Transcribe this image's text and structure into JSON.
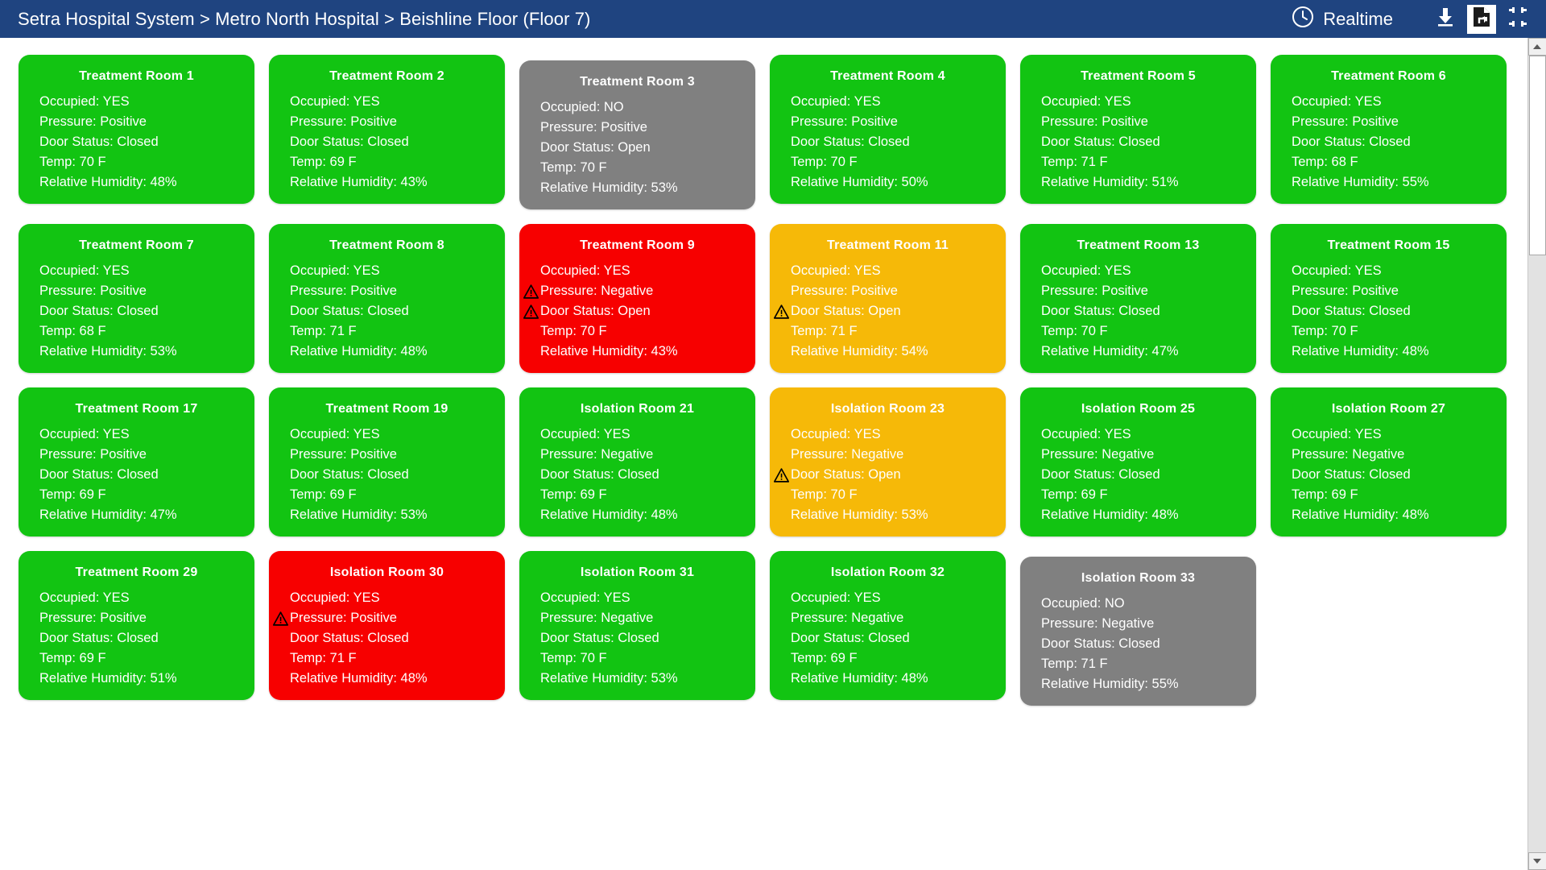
{
  "header": {
    "breadcrumb": "Setra Hospital System > Metro North Hospital > Beishline Floor (Floor 7)",
    "mode_label": "Realtime",
    "clock_icon": "clock-icon",
    "download_icon": "download-icon",
    "export_icon": "export-document-icon",
    "collapse_icon": "collapse-fullscreen-icon"
  },
  "labels": {
    "occupied": "Occupied",
    "pressure": "Pressure",
    "door_status": "Door Status",
    "temp": "Temp",
    "humidity": "Relative Humidity"
  },
  "colors": {
    "header_bg": "#1f4480",
    "status_green": "#12c412",
    "status_red": "#f70000",
    "status_yellow": "#f6b908",
    "status_gray": "#808080",
    "text": "#ffffff",
    "warning": "#000000"
  },
  "rooms": [
    [
      {
        "name": "Treatment Room 1",
        "status": "green",
        "lines": [
          {
            "text": "Occupied: YES",
            "warn": false
          },
          {
            "text": "Pressure: Positive",
            "warn": false
          },
          {
            "text": "Door Status: Closed",
            "warn": false
          },
          {
            "text": "Temp: 70 F",
            "warn": false
          },
          {
            "text": "Relative Humidity: 48%",
            "warn": false
          }
        ]
      },
      {
        "name": "Treatment Room 2",
        "status": "green",
        "lines": [
          {
            "text": "Occupied: YES",
            "warn": false
          },
          {
            "text": "Pressure: Positive",
            "warn": false
          },
          {
            "text": "Door Status: Closed",
            "warn": false
          },
          {
            "text": "Temp: 69 F",
            "warn": false
          },
          {
            "text": "Relative Humidity: 43%",
            "warn": false
          }
        ]
      },
      {
        "name": "Treatment Room 3",
        "status": "gray",
        "lines": [
          {
            "text": "Occupied: NO",
            "warn": false
          },
          {
            "text": "Pressure: Positive",
            "warn": false
          },
          {
            "text": "Door Status: Open",
            "warn": false
          },
          {
            "text": "Temp: 70 F",
            "warn": false
          },
          {
            "text": "Relative Humidity: 53%",
            "warn": false
          }
        ]
      },
      {
        "name": "Treatment Room 4",
        "status": "green",
        "lines": [
          {
            "text": "Occupied: YES",
            "warn": false
          },
          {
            "text": "Pressure: Positive",
            "warn": false
          },
          {
            "text": "Door Status: Closed",
            "warn": false
          },
          {
            "text": "Temp: 70 F",
            "warn": false
          },
          {
            "text": "Relative Humidity: 50%",
            "warn": false
          }
        ]
      },
      {
        "name": "Treatment Room 5",
        "status": "green",
        "lines": [
          {
            "text": "Occupied: YES",
            "warn": false
          },
          {
            "text": "Pressure: Positive",
            "warn": false
          },
          {
            "text": "Door Status: Closed",
            "warn": false
          },
          {
            "text": "Temp: 71 F",
            "warn": false
          },
          {
            "text": "Relative Humidity: 51%",
            "warn": false
          }
        ]
      },
      {
        "name": "Treatment Room 6",
        "status": "green",
        "lines": [
          {
            "text": "Occupied: YES",
            "warn": false
          },
          {
            "text": "Pressure: Positive",
            "warn": false
          },
          {
            "text": "Door Status: Closed",
            "warn": false
          },
          {
            "text": "Temp: 68 F",
            "warn": false
          },
          {
            "text": "Relative Humidity: 55%",
            "warn": false
          }
        ]
      }
    ],
    [
      {
        "name": "Treatment Room 7",
        "status": "green",
        "lines": [
          {
            "text": "Occupied: YES",
            "warn": false
          },
          {
            "text": "Pressure: Positive",
            "warn": false
          },
          {
            "text": "Door Status: Closed",
            "warn": false
          },
          {
            "text": "Temp: 68 F",
            "warn": false
          },
          {
            "text": "Relative Humidity: 53%",
            "warn": false
          }
        ]
      },
      {
        "name": "Treatment Room 8",
        "status": "green",
        "lines": [
          {
            "text": "Occupied: YES",
            "warn": false
          },
          {
            "text": "Pressure: Positive",
            "warn": false
          },
          {
            "text": "Door Status: Closed",
            "warn": false
          },
          {
            "text": "Temp: 71 F",
            "warn": false
          },
          {
            "text": "Relative Humidity: 48%",
            "warn": false
          }
        ]
      },
      {
        "name": "Treatment Room 9",
        "status": "red",
        "lines": [
          {
            "text": "Occupied: YES",
            "warn": false
          },
          {
            "text": "Pressure: Negative",
            "warn": true
          },
          {
            "text": "Door Status: Open",
            "warn": true
          },
          {
            "text": "Temp: 70 F",
            "warn": false
          },
          {
            "text": "Relative Humidity: 43%",
            "warn": false
          }
        ]
      },
      {
        "name": "Treatment Room 11",
        "status": "yellow",
        "lines": [
          {
            "text": "Occupied: YES",
            "warn": false
          },
          {
            "text": "Pressure: Positive",
            "warn": false
          },
          {
            "text": "Door Status: Open",
            "warn": true
          },
          {
            "text": "Temp: 71 F",
            "warn": false
          },
          {
            "text": "Relative Humidity: 54%",
            "warn": false
          }
        ]
      },
      {
        "name": "Treatment Room 13",
        "status": "green",
        "lines": [
          {
            "text": "Occupied: YES",
            "warn": false
          },
          {
            "text": "Pressure: Positive",
            "warn": false
          },
          {
            "text": "Door Status: Closed",
            "warn": false
          },
          {
            "text": "Temp: 70 F",
            "warn": false
          },
          {
            "text": "Relative Humidity: 47%",
            "warn": false
          }
        ]
      },
      {
        "name": "Treatment Room 15",
        "status": "green",
        "lines": [
          {
            "text": "Occupied: YES",
            "warn": false
          },
          {
            "text": "Pressure: Positive",
            "warn": false
          },
          {
            "text": "Door Status: Closed",
            "warn": false
          },
          {
            "text": "Temp: 70 F",
            "warn": false
          },
          {
            "text": "Relative Humidity: 48%",
            "warn": false
          }
        ]
      }
    ],
    [
      {
        "name": "Treatment Room 17",
        "status": "green",
        "lines": [
          {
            "text": "Occupied: YES",
            "warn": false
          },
          {
            "text": "Pressure: Positive",
            "warn": false
          },
          {
            "text": "Door Status: Closed",
            "warn": false
          },
          {
            "text": "Temp: 69 F",
            "warn": false
          },
          {
            "text": "Relative Humidity: 47%",
            "warn": false
          }
        ]
      },
      {
        "name": "Treatment Room 19",
        "status": "green",
        "lines": [
          {
            "text": "Occupied: YES",
            "warn": false
          },
          {
            "text": "Pressure: Positive",
            "warn": false
          },
          {
            "text": "Door Status: Closed",
            "warn": false
          },
          {
            "text": "Temp: 69 F",
            "warn": false
          },
          {
            "text": "Relative Humidity: 53%",
            "warn": false
          }
        ]
      },
      {
        "name": "Isolation Room 21",
        "status": "green",
        "lines": [
          {
            "text": "Occupied: YES",
            "warn": false
          },
          {
            "text": "Pressure: Negative",
            "warn": false
          },
          {
            "text": "Door Status: Closed",
            "warn": false
          },
          {
            "text": "Temp: 69 F",
            "warn": false
          },
          {
            "text": "Relative Humidity: 48%",
            "warn": false
          }
        ]
      },
      {
        "name": "Isolation Room 23",
        "status": "yellow",
        "lines": [
          {
            "text": "Occupied: YES",
            "warn": false
          },
          {
            "text": "Pressure: Negative",
            "warn": false
          },
          {
            "text": "Door Status: Open",
            "warn": true
          },
          {
            "text": "Temp: 70 F",
            "warn": false
          },
          {
            "text": "Relative Humidity: 53%",
            "warn": false
          }
        ]
      },
      {
        "name": "Isolation Room 25",
        "status": "green",
        "lines": [
          {
            "text": "Occupied: YES",
            "warn": false
          },
          {
            "text": "Pressure: Negative",
            "warn": false
          },
          {
            "text": "Door Status: Closed",
            "warn": false
          },
          {
            "text": "Temp: 69 F",
            "warn": false
          },
          {
            "text": "Relative Humidity: 48%",
            "warn": false
          }
        ]
      },
      {
        "name": "Isolation Room 27",
        "status": "green",
        "lines": [
          {
            "text": "Occupied: YES",
            "warn": false
          },
          {
            "text": "Pressure: Negative",
            "warn": false
          },
          {
            "text": "Door Status: Closed",
            "warn": false
          },
          {
            "text": "Temp: 69 F",
            "warn": false
          },
          {
            "text": "Relative Humidity: 48%",
            "warn": false
          }
        ]
      }
    ],
    [
      {
        "name": "Treatment Room 29",
        "status": "green",
        "lines": [
          {
            "text": "Occupied: YES",
            "warn": false
          },
          {
            "text": "Pressure: Positive",
            "warn": false
          },
          {
            "text": "Door Status: Closed",
            "warn": false
          },
          {
            "text": "Temp: 69 F",
            "warn": false
          },
          {
            "text": "Relative Humidity: 51%",
            "warn": false
          }
        ]
      },
      {
        "name": "Isolation Room 30",
        "status": "red",
        "lines": [
          {
            "text": "Occupied: YES",
            "warn": false
          },
          {
            "text": "Pressure: Positive",
            "warn": true
          },
          {
            "text": "Door Status: Closed",
            "warn": false
          },
          {
            "text": "Temp: 71 F",
            "warn": false
          },
          {
            "text": "Relative Humidity: 48%",
            "warn": false
          }
        ]
      },
      {
        "name": "Isolation Room 31",
        "status": "green",
        "lines": [
          {
            "text": "Occupied: YES",
            "warn": false
          },
          {
            "text": "Pressure: Negative",
            "warn": false
          },
          {
            "text": "Door Status: Closed",
            "warn": false
          },
          {
            "text": "Temp: 70 F",
            "warn": false
          },
          {
            "text": "Relative Humidity: 53%",
            "warn": false
          }
        ]
      },
      {
        "name": "Isolation Room 32",
        "status": "green",
        "lines": [
          {
            "text": "Occupied: YES",
            "warn": false
          },
          {
            "text": "Pressure: Negative",
            "warn": false
          },
          {
            "text": "Door Status: Closed",
            "warn": false
          },
          {
            "text": "Temp: 69 F",
            "warn": false
          },
          {
            "text": "Relative Humidity: 48%",
            "warn": false
          }
        ]
      },
      {
        "name": "Isolation Room 33",
        "status": "gray",
        "lines": [
          {
            "text": "Occupied: NO",
            "warn": false
          },
          {
            "text": "Pressure: Negative",
            "warn": false
          },
          {
            "text": "Door Status: Closed",
            "warn": false
          },
          {
            "text": "Temp: 71 F",
            "warn": false
          },
          {
            "text": "Relative Humidity: 55%",
            "warn": false
          }
        ]
      }
    ]
  ]
}
